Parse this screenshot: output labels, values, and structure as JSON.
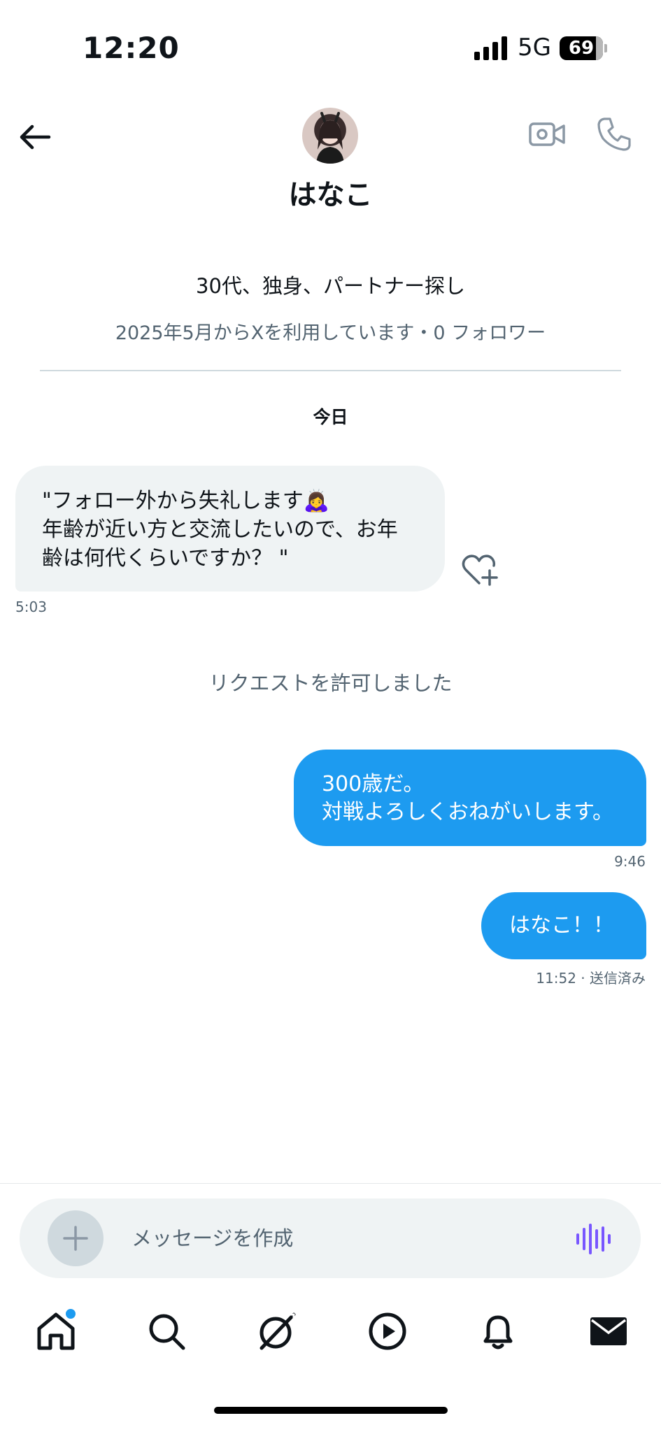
{
  "status_bar": {
    "time": "12:20",
    "carrier": "5G",
    "battery": "69"
  },
  "header": {
    "name": "はなこ"
  },
  "profile": {
    "bio": "30代、独身、パートナー探し",
    "meta": "2025年5月からXを利用しています・0 フォロワー"
  },
  "conversation": {
    "date_label": "今日",
    "messages": [
      {
        "lines": [
          "\"フォロー外から失礼します🙇‍♀️",
          "年齢が近い方と交流したいので、お年",
          "齢は何代くらいですか？ \""
        ],
        "time": "5:03"
      },
      {
        "lines": [
          "300歳だ。",
          "対戦よろしくおねがいします。"
        ],
        "time": "9:46"
      },
      {
        "lines": [
          "はなこ！！"
        ],
        "time": "11:52 · 送信済み"
      }
    ],
    "system_notice": "リクエストを許可しました"
  },
  "composer": {
    "placeholder": "メッセージを作成"
  },
  "colors": {
    "accent": "#1d9bf0",
    "bubble_in": "#eff3f4",
    "muted_text": "#536471",
    "voice": "#7856ff"
  },
  "icons": [
    "back-arrow-icon",
    "video-call-icon",
    "phone-icon",
    "heart-plus-icon",
    "plus-icon",
    "voice-wave-icon",
    "home-icon",
    "search-icon",
    "grok-icon",
    "play-icon",
    "bell-icon",
    "mail-icon"
  ]
}
